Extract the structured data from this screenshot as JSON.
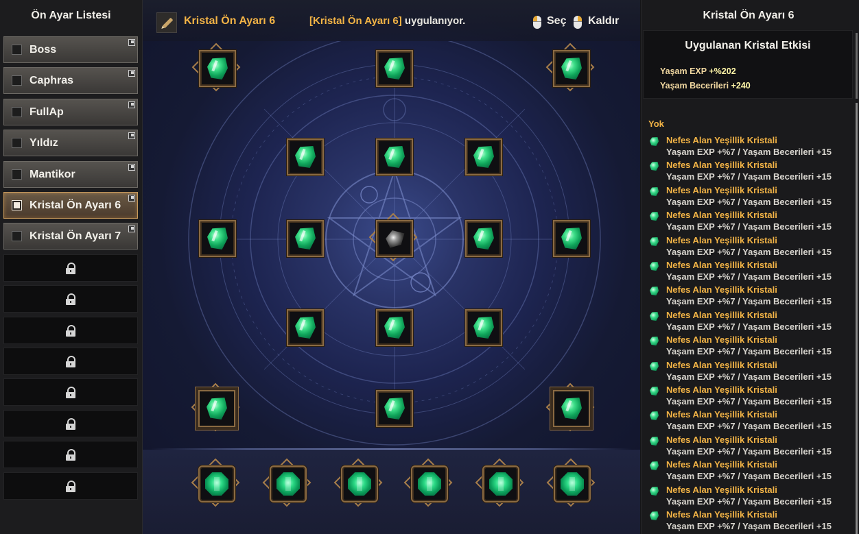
{
  "left_panel": {
    "title": "Ön Ayar Listesi",
    "presets": [
      {
        "label": "Boss",
        "active": false
      },
      {
        "label": "Caphras",
        "active": false
      },
      {
        "label": "FullAp",
        "active": false
      },
      {
        "label": "Yıldız",
        "active": false
      },
      {
        "label": "Mantikor",
        "active": false
      },
      {
        "label": "Kristal Ön Ayarı 6",
        "active": true
      },
      {
        "label": "Kristal Ön Ayarı 7",
        "active": false
      }
    ],
    "locked_slot_count": 8
  },
  "header": {
    "preset_name": "Kristal Ön Ayarı 6",
    "applying_highlight": "[Kristal Ön Ayarı 6]",
    "applying_suffix": " uygulanıyor.",
    "select_label": "Seç",
    "remove_label": "Kaldır",
    "edit_icon": "pencil-icon"
  },
  "crystal_board": {
    "center_socket": "dark-crystal",
    "filled_sockets": 18,
    "bottom_sockets": 6,
    "gem_color": "#2bd985",
    "frame_color": "#8a6a42"
  },
  "right_panel": {
    "title": "Kristal Ön Ayarı 6",
    "effect_title": "Uygulanan Kristal Etkisi",
    "effects": [
      {
        "label": "Yaşam EXP",
        "value": "+%202"
      },
      {
        "label": "Yaşam Becerileri",
        "value": "+240"
      }
    ],
    "group_label": "Yok",
    "crystals": [
      {
        "name": "Nefes Alan Yeşillik Kristali",
        "effect": "Yaşam EXP +%7 / Yaşam Becerileri +15"
      },
      {
        "name": "Nefes Alan Yeşillik Kristali",
        "effect": "Yaşam EXP +%7 / Yaşam Becerileri +15"
      },
      {
        "name": "Nefes Alan Yeşillik Kristali",
        "effect": "Yaşam EXP +%7 / Yaşam Becerileri +15"
      },
      {
        "name": "Nefes Alan Yeşillik Kristali",
        "effect": "Yaşam EXP +%7 / Yaşam Becerileri +15"
      },
      {
        "name": "Nefes Alan Yeşillik Kristali",
        "effect": "Yaşam EXP +%7 / Yaşam Becerileri +15"
      },
      {
        "name": "Nefes Alan Yeşillik Kristali",
        "effect": "Yaşam EXP +%7 / Yaşam Becerileri +15"
      },
      {
        "name": "Nefes Alan Yeşillik Kristali",
        "effect": "Yaşam EXP +%7 / Yaşam Becerileri +15"
      },
      {
        "name": "Nefes Alan Yeşillik Kristali",
        "effect": "Yaşam EXP +%7 / Yaşam Becerileri +15"
      },
      {
        "name": "Nefes Alan Yeşillik Kristali",
        "effect": "Yaşam EXP +%7 / Yaşam Becerileri +15"
      },
      {
        "name": "Nefes Alan Yeşillik Kristali",
        "effect": "Yaşam EXP +%7 / Yaşam Becerileri +15"
      },
      {
        "name": "Nefes Alan Yeşillik Kristali",
        "effect": "Yaşam EXP +%7 / Yaşam Becerileri +15"
      },
      {
        "name": "Nefes Alan Yeşillik Kristali",
        "effect": "Yaşam EXP +%7 / Yaşam Becerileri +15"
      },
      {
        "name": "Nefes Alan Yeşillik Kristali",
        "effect": "Yaşam EXP +%7 / Yaşam Becerileri +15"
      },
      {
        "name": "Nefes Alan Yeşillik Kristali",
        "effect": "Yaşam EXP +%7 / Yaşam Becerileri +15"
      },
      {
        "name": "Nefes Alan Yeşillik Kristali",
        "effect": "Yaşam EXP +%7 / Yaşam Becerileri +15"
      },
      {
        "name": "Nefes Alan Yeşillik Kristali",
        "effect": "Yaşam EXP +%7 / Yaşam Becerileri +15"
      }
    ]
  }
}
